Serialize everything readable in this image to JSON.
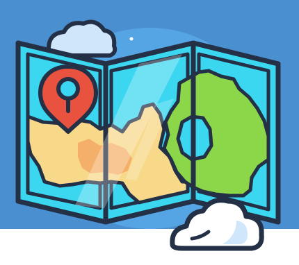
{
  "illustration": {
    "subject": "folded-map-with-location-pin",
    "icon_names": [
      "map-icon",
      "location-pin-icon",
      "cloud-icon"
    ],
    "colors": {
      "background_band": "#4A8FCF",
      "outline": "#243046",
      "map_water": "#3BD6F0",
      "map_water_light": "#8FE8F7",
      "land_green": "#8CD64A",
      "land_yellow": "#F8D889",
      "land_orange": "#F4B06A",
      "pin_red": "#E8523F",
      "pin_hole": "#3BD6F0",
      "cloud_white": "#FFFFFF",
      "cloud_shade": "#CFE6FB",
      "glow_blue": "#5FB6F4"
    }
  }
}
